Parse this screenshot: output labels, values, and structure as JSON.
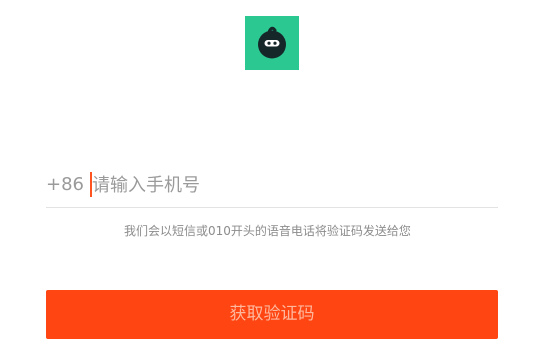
{
  "logo": {
    "icon": "app-logo-icon",
    "background_color": "#2cc891"
  },
  "phone": {
    "country_code": "+86",
    "placeholder": "请输入手机号",
    "value": "",
    "cursor_color": "#ff5320"
  },
  "hint": {
    "text": "我们会以短信或010开头的语音电话将验证码发送给您"
  },
  "submit": {
    "label": "获取验证码",
    "background_color": "#ff4511"
  }
}
